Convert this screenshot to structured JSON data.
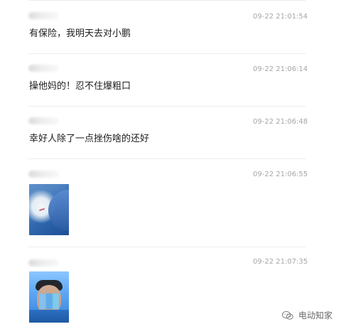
{
  "messages": [
    {
      "time": "09-22 21:01:54",
      "content": "有保险，我明天去对小鹏"
    },
    {
      "time": "09-22 21:06:14",
      "content": "操他妈的！忍不住爆粗口"
    },
    {
      "time": "09-22 21:06:48",
      "content": "幸好人除了一点挫伤啥的还好"
    },
    {
      "time": "09-22 21:06:55"
    },
    {
      "time": "09-22 21:07:35"
    }
  ],
  "watermark": {
    "text": "电动知家",
    "icon": "wechat-icon"
  }
}
